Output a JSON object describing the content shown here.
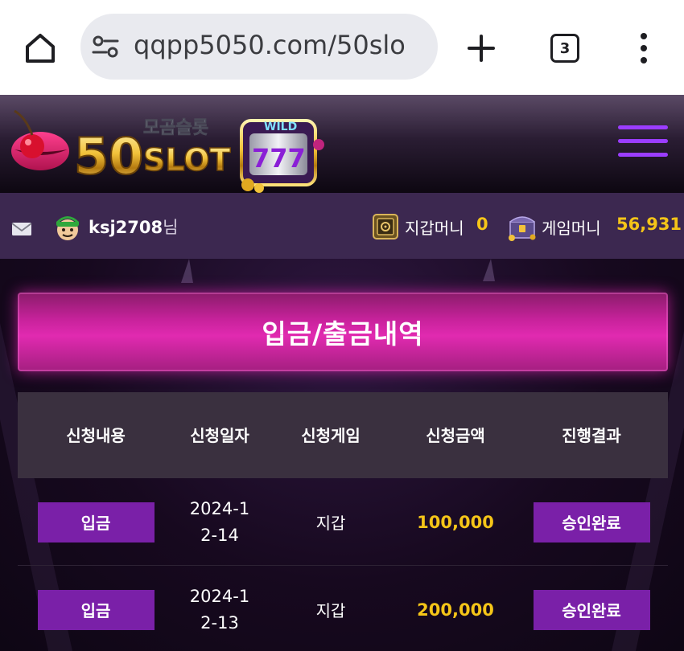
{
  "browser": {
    "url": "qqpp5050.com/50slo",
    "tab_count": "3"
  },
  "site": {
    "logo_korean": "모곰슬롯",
    "logo_number": "50",
    "logo_word": "SLOT",
    "logo_wild": "WILD",
    "logo_reels": "777"
  },
  "user_bar": {
    "username": "ksj2708",
    "username_suffix": "님",
    "wallet_label": "지갑머니",
    "wallet_value": "0",
    "game_money_label": "게임머니",
    "game_money_value": "56,931"
  },
  "page": {
    "title": "입금/출금내역"
  },
  "table": {
    "headers": [
      "신청내용",
      "신청일자",
      "신청게임",
      "신청금액",
      "진행결과"
    ],
    "rows": [
      {
        "type": "입금",
        "date": "2024-12-14",
        "game": "지갑",
        "amount": "100,000",
        "status": "승인완료"
      },
      {
        "type": "입금",
        "date": "2024-12-13",
        "game": "지갑",
        "amount": "200,000",
        "status": "승인완료"
      }
    ]
  },
  "colors": {
    "accent_purple": "#7a20a8",
    "banner_pink": "#e12ab0",
    "amount_gold": "#f5c518"
  }
}
